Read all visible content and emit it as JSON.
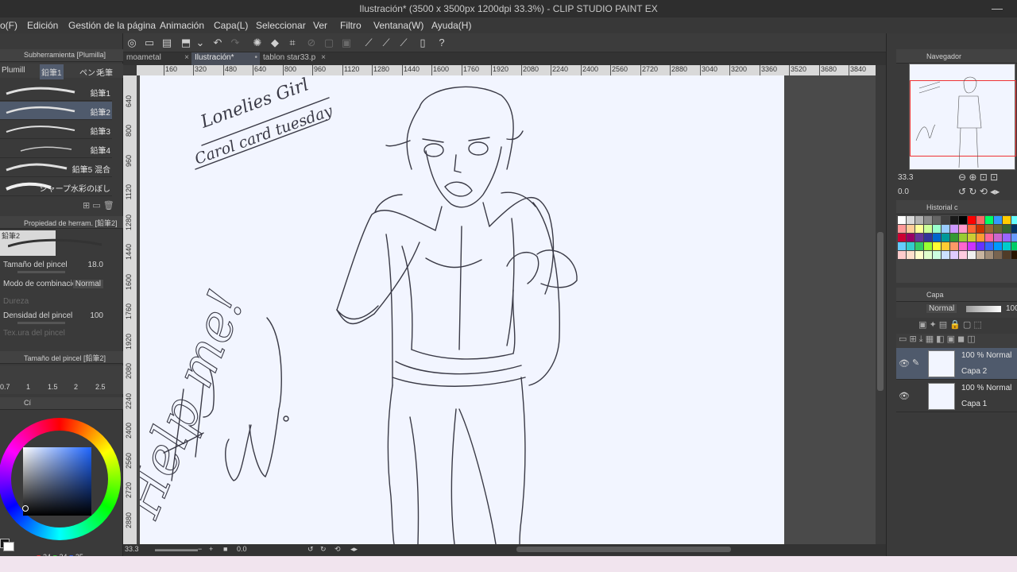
{
  "window": {
    "title": "Ilustración* (3500 x 3500px 1200dpi 33.3%) - CLIP STUDIO PAINT EX"
  },
  "menu": [
    "o(F)",
    "Edición",
    "Gestión de la página",
    "Animación",
    "Capa(L)",
    "Seleccionar",
    "Ver",
    "Filtro",
    "Ventana(W)",
    "Ayuda(H)"
  ],
  "tabs": [
    {
      "label": "moametal",
      "active": false
    },
    {
      "label": "Ilustración*",
      "active": true
    },
    {
      "label": "tablon star33.p",
      "active": false
    }
  ],
  "ruler_top": [
    "160",
    "320",
    "480",
    "640",
    "800",
    "960",
    "1120",
    "1280",
    "1440",
    "1600",
    "1760",
    "1920",
    "2080",
    "2240",
    "2400",
    "2560",
    "2720",
    "2880",
    "3040",
    "3200",
    "3360",
    "3520",
    "3680",
    "3840"
  ],
  "ruler_left": [
    "640",
    "800",
    "960",
    "1120",
    "1280",
    "1440",
    "1600",
    "1760",
    "1920",
    "2080",
    "2240",
    "2400",
    "2560",
    "2720",
    "2880"
  ],
  "subtool": {
    "header": "Subherramienta [Plumilla]",
    "tabs": [
      "Plumill",
      "鉛筆1",
      "ペンシ",
      "毛筆"
    ],
    "brushes": [
      {
        "label": "鉛筆1",
        "selected": false
      },
      {
        "label": "鉛筆2",
        "selected": true
      },
      {
        "label": "鉛筆3",
        "selected": false
      },
      {
        "label": "鉛筆4",
        "selected": false
      },
      {
        "label": "鉛筆5 混合",
        "selected": false
      },
      {
        "label": "シャープ水彩のぼし",
        "selected": false
      }
    ]
  },
  "tool_property": {
    "header": "Propiedad de herram. [鉛筆2]",
    "preset_label": "鉛筆2",
    "brush_size_label": "Tamaño del pincel",
    "brush_size_value": "18.0",
    "blend_label": "Modo de combinación",
    "blend_value": "Normal",
    "hardness_label": "Dureza",
    "density_label": "Densidad del pincel",
    "density_value": "100",
    "partial_label": "Tex.ura del pincel"
  },
  "brush_size_panel": {
    "header": "Tamaño del pincel [鉛筆2]",
    "sizes": [
      "0.7",
      "1",
      "1.5",
      "2",
      "2.5"
    ]
  },
  "color": {
    "tab_label": "Cí",
    "r": "24",
    "g": "24",
    "b": "25",
    "current": "#181819",
    "square_base": "#1f66ff"
  },
  "navigator": {
    "header": "Navegador",
    "zoom": "33.3",
    "rotation": "0.0"
  },
  "history": {
    "header": "Historial c"
  },
  "palette": [
    "#ffffff",
    "#d9d9d9",
    "#b3b3b3",
    "#8c8c8c",
    "#666666",
    "#404040",
    "#1a1a1a",
    "#000000",
    "#ff0000",
    "#ff6666",
    "#00ff66",
    "#3399ff",
    "#ffcc00",
    "#66ffff",
    "#ff9999",
    "#ffcc99",
    "#ffff99",
    "#ccff99",
    "#99ffcc",
    "#99ccff",
    "#cc99ff",
    "#ff99cc",
    "#ff6633",
    "#cc3300",
    "#996633",
    "#666633",
    "#336633",
    "#003366",
    "#cc0033",
    "#990066",
    "#663399",
    "#333399",
    "#0066cc",
    "#009999",
    "#339933",
    "#99cc33",
    "#cccc33",
    "#ff9933",
    "#ff6699",
    "#cc66cc",
    "#9966ff",
    "#6699ff",
    "#66ccff",
    "#33cccc",
    "#33cc66",
    "#99ff33",
    "#ffff33",
    "#ffcc33",
    "#ff9966",
    "#ff66cc",
    "#cc33ff",
    "#6633ff",
    "#3366ff",
    "#0099ff",
    "#00cccc",
    "#00cc66",
    "#ffcccc",
    "#ffe0cc",
    "#ffffcc",
    "#e0ffcc",
    "#ccffe0",
    "#cce0ff",
    "#e0ccff",
    "#ffcce0",
    "#f0f0f0",
    "#c8b4a0",
    "#a08c78",
    "#786450",
    "#503c28",
    "#281400"
  ],
  "layers": {
    "header": "Capa",
    "blend_mode": "Normal",
    "opacity": "100",
    "items": [
      {
        "mode": "100 % Normal",
        "name": "Capa 2",
        "selected": true
      },
      {
        "mode": "100 % Normal",
        "name": "Capa 1",
        "selected": false
      }
    ]
  },
  "sketch_text": {
    "line1": "Lonelies Girl",
    "line2": "Carol card tuesday",
    "help": "Help me!"
  },
  "status": {
    "zoom": "33.3",
    "rotation": "0.0"
  }
}
